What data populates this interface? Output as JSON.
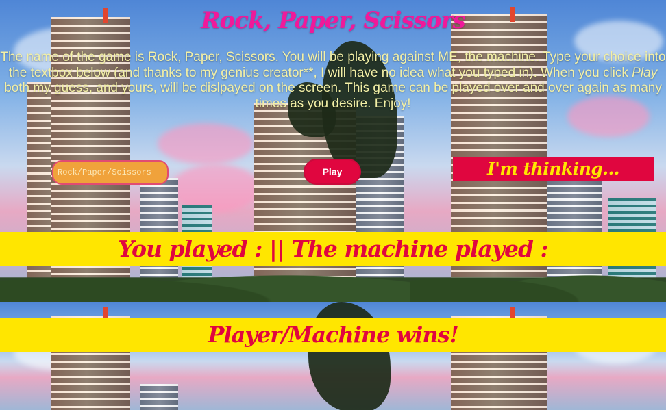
{
  "page": {
    "title": "Rock, Paper, Scissors",
    "intro_part1": "The name of the game is Rock, Paper, Scissors. You will be playing against ME, the machine. Type your choice into the textbox below (and thanks to my genius creator**, I will have no idea what you typed in). When you click ",
    "intro_emphasis": "Play",
    "intro_part2": " both my guess, and yours, will be dislpayed on the screen. This game can be played over and over again as many times as you desire. Enjoy!"
  },
  "controls": {
    "input_placeholder": "Rock/Paper/Scissors",
    "input_value": "",
    "play_label": "Play",
    "machine_status": "I'm thinking..."
  },
  "results": {
    "played_line": "You played : || The machine played :",
    "winner_line": "Player/Machine wins!"
  },
  "colors": {
    "title": "#f0199a",
    "intro_text": "#f3f0a6",
    "accent_red": "#e0063f",
    "accent_yellow": "#ffe600",
    "input_bg": "#f0a23b"
  }
}
